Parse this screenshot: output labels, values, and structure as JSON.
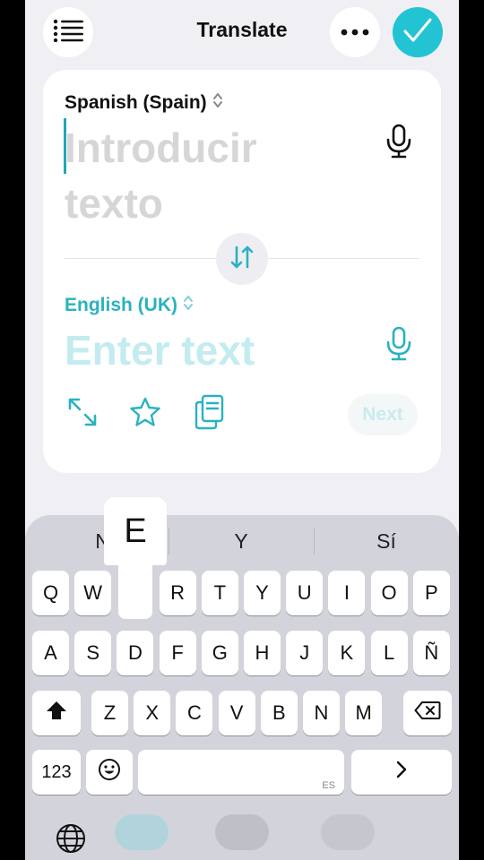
{
  "header": {
    "title": "Translate",
    "list_icon": "list-icon",
    "more_icon": "more-icon",
    "done_icon": "check-icon",
    "accent": "#22c4d4"
  },
  "source": {
    "language": "Spanish (Spain)",
    "placeholder": "Introducir texto",
    "mic_icon": "microphone-icon"
  },
  "target": {
    "language": "English (UK)",
    "placeholder": "Enter text",
    "mic_icon": "microphone-icon",
    "color": "#2ab2c0"
  },
  "swap_icon": "swap-arrows-icon",
  "tools": {
    "expand_icon": "expand-icon",
    "favorite_icon": "star-icon",
    "copy_icon": "copy-icon",
    "next_label": "Next"
  },
  "keyboard": {
    "suggestions": [
      "No",
      "Y",
      "Sí"
    ],
    "pressed_key": "E",
    "row1": [
      "Q",
      "W",
      "E",
      "R",
      "T",
      "Y",
      "U",
      "I",
      "O",
      "P"
    ],
    "row2": [
      "A",
      "S",
      "D",
      "F",
      "G",
      "H",
      "J",
      "K",
      "L",
      "Ñ"
    ],
    "row3": [
      "Z",
      "X",
      "C",
      "V",
      "B",
      "N",
      "M"
    ],
    "numbers_label": "123",
    "space_lang": "ES",
    "emoji_icon": "emoji-icon",
    "shift_icon": "shift-icon",
    "delete_icon": "backspace-icon",
    "next_icon": "chevron-right-icon",
    "globe_icon": "globe-icon"
  }
}
